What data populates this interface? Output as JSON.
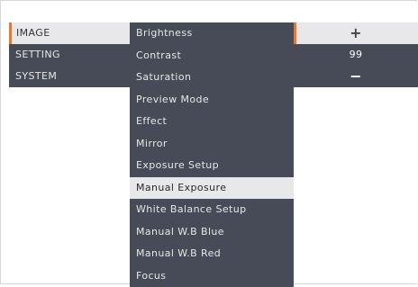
{
  "main_menu": [
    {
      "label": "IMAGE",
      "active": true
    },
    {
      "label": "SETTING",
      "active": false
    },
    {
      "label": "SYSTEM",
      "active": false
    }
  ],
  "image_submenu": [
    {
      "label": "Brightness"
    },
    {
      "label": "Contrast"
    },
    {
      "label": "Saturation"
    },
    {
      "label": "Preview Mode"
    },
    {
      "label": "Effect"
    },
    {
      "label": "Mirror"
    },
    {
      "label": "Exposure Setup"
    },
    {
      "label": "Manual Exposure",
      "active": true
    },
    {
      "label": "White Balance Setup"
    },
    {
      "label": "Manual W.B Blue"
    },
    {
      "label": "Manual W.B Red"
    },
    {
      "label": "Focus"
    }
  ],
  "value_control": {
    "increase_symbol": "+",
    "value": "99",
    "decrease_symbol": "−"
  },
  "colors": {
    "menu_bg": "#474b58",
    "active_bg": "#e8e8ea",
    "accent": "#e8782c"
  }
}
